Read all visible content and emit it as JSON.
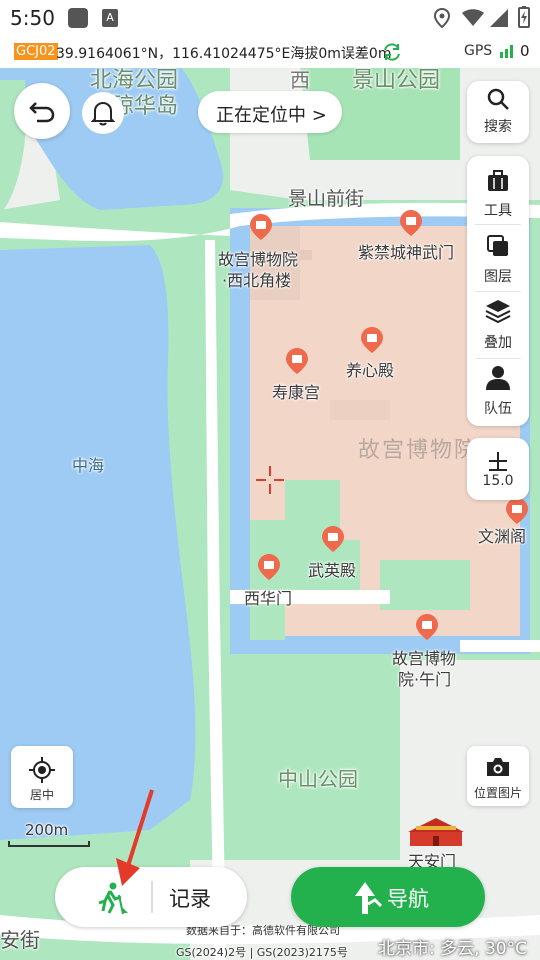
{
  "status_bar": {
    "time": "5:50"
  },
  "coord_bar": {
    "crs_badge": "GCJ02",
    "coords_text": "39.9164061°N，116.41024475°E海拔0m误差0m",
    "gps_label": "GPS"
  },
  "top": {
    "locating_label": "正在定位中 >"
  },
  "right_toolbar": {
    "search_label": "搜索",
    "tools_label": "工具",
    "layers_label": "图层",
    "overlay_label": "叠加",
    "team_label": "队伍",
    "zoom_level": "15.0"
  },
  "map": {
    "labels": {
      "beihai": "北海公园",
      "qionghua": "琼华岛",
      "jingshan_park": "景山公园",
      "jingshan_front": "景山前街",
      "palace_nw": "故宫博物院",
      "palace_nw2": "·西北角楼",
      "shenwumen": "紫禁城神武门",
      "yangxindian": "养心殿",
      "shoukanggong": "寿康宫",
      "palace_museum": "故宫博物院",
      "zhonghai": "中海",
      "wenyuange": "文渊阁",
      "wuyingdian": "武英殿",
      "xihuamen": "西华门",
      "wumen1": "故宫博物",
      "wumen2": "院·午门",
      "zhongshan": "中山公园",
      "tiananmen": "天安门",
      "changan": "安街",
      "scale": "200m",
      "attribution": "数据来自于：高德软件有限公司",
      "gs_number": "GS(2024)2号 | GS(2023)2175号",
      "weather": "北京市: 多云, 30°C",
      "west_top": "西"
    }
  },
  "left_controls": {
    "center_label": "居中"
  },
  "right_controls": {
    "photo_label": "位置图片"
  },
  "bottom": {
    "record_label": "记录",
    "navigate_label": "导航"
  },
  "colors": {
    "accent_green": "#22b14c",
    "badge_orange": "#f7941d",
    "water": "#9ecbf3",
    "park": "#a8e6b8",
    "palace": "#f1d6c8"
  }
}
